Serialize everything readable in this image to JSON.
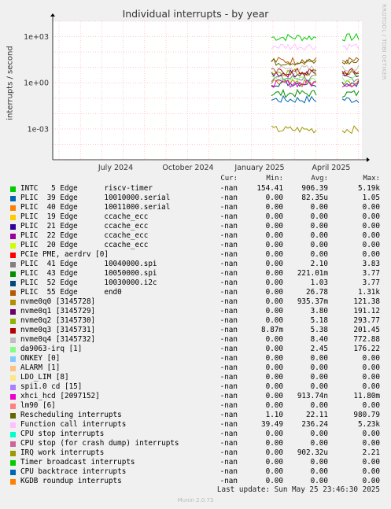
{
  "chart_data": {
    "type": "line",
    "title": "Individual interrupts - by year",
    "ylabel": "interrupts / second",
    "yscale": "log",
    "ylim": [
      1e-05,
      10000
    ],
    "y_ticks": [
      "1e+03",
      "1e+00",
      "1e-03"
    ],
    "x_ticks": [
      "July 2024",
      "October 2024",
      "January 2025",
      "April 2025"
    ],
    "grid": true,
    "series": [
      {
        "name": "INTC   5 Edge      riscv-timer",
        "color": "#00cc00",
        "approx_level": 900
      },
      {
        "name": "PLIC  39 Edge      10010000.serial",
        "color": "#0066b3",
        "approx_level": 0.08
      },
      {
        "name": "PLIC  40 Edge      10011000.serial",
        "color": "#ff8000",
        "approx_level": 0
      },
      {
        "name": "PLIC  19 Edge      ccache_ecc",
        "color": "#ffcc00",
        "approx_level": 0
      },
      {
        "name": "PLIC  21 Edge      ccache_ecc",
        "color": "#330099",
        "approx_level": 0
      },
      {
        "name": "PLIC  22 Edge      ccache_ecc",
        "color": "#990099",
        "approx_level": 0
      },
      {
        "name": "PLIC  20 Edge      ccache_ecc",
        "color": "#ccff00",
        "approx_level": 0
      },
      {
        "name": "PCIe PME, aerdrv [0]",
        "color": "#ff0000",
        "approx_level": 0
      },
      {
        "name": "PLIC  41 Edge      10040000.spi",
        "color": "#808080",
        "approx_level": 2
      },
      {
        "name": "PLIC  43 Edge      10050000.spi",
        "color": "#008f00",
        "approx_level": 0.2
      },
      {
        "name": "PLIC  52 Edge      10030000.i2c",
        "color": "#00487d",
        "approx_level": 1
      },
      {
        "name": "PLIC  55 Edge      end0",
        "color": "#b35a00",
        "approx_level": 27
      },
      {
        "name": "nvme0q0 [3145728]",
        "color": "#b38f00",
        "approx_level": 0.9
      },
      {
        "name": "nvme0q1 [3145729]",
        "color": "#6b006b",
        "approx_level": 4
      },
      {
        "name": "nvme0q2 [3145730]",
        "color": "#8fb300",
        "approx_level": 5
      },
      {
        "name": "nvme0q3 [3145731]",
        "color": "#b30000",
        "approx_level": 5
      },
      {
        "name": "nvme0q4 [3145732]",
        "color": "#bebebe",
        "approx_level": 8
      },
      {
        "name": "da9063-irq [1]",
        "color": "#80ff80",
        "approx_level": 2
      },
      {
        "name": "ONKEY [0]",
        "color": "#80c9ff",
        "approx_level": 0
      },
      {
        "name": "ALARM [1]",
        "color": "#ffc080",
        "approx_level": 0
      },
      {
        "name": "LDO_LIM [8]",
        "color": "#ffe680",
        "approx_level": 0
      },
      {
        "name": "spi1.0 cd [15]",
        "color": "#aa80ff",
        "approx_level": 0
      },
      {
        "name": "xhci_hcd [2097152]",
        "color": "#ee00cc",
        "approx_level": 0.9
      },
      {
        "name": "lm90 [6]",
        "color": "#ff8080",
        "approx_level": 0
      },
      {
        "name": "Rescheduling interrupts",
        "color": "#666600",
        "approx_level": 22
      },
      {
        "name": "Function call interrupts",
        "color": "#ffbfff",
        "approx_level": 236
      },
      {
        "name": "CPU stop interrupts",
        "color": "#00ffcc",
        "approx_level": 0
      },
      {
        "name": "CPU stop (for crash dump) interrupts",
        "color": "#cc6699",
        "approx_level": 0
      },
      {
        "name": "IRQ work interrupts",
        "color": "#999900",
        "approx_level": 0.0009
      },
      {
        "name": "Timer broadcast interrupts",
        "color": "#00cc00",
        "approx_level": 0
      },
      {
        "name": "CPU backtrace interrupts",
        "color": "#0066b3",
        "approx_level": 0
      },
      {
        "name": "KGDB roundup interrupts",
        "color": "#ff8000",
        "approx_level": 0
      }
    ]
  },
  "legend": {
    "headers": [
      "Cur:",
      "Min:",
      "Avg:",
      "Max:"
    ],
    "rows": [
      [
        "INTC   5 Edge      riscv-timer",
        "-nan",
        "154.41",
        "906.39",
        "5.19k"
      ],
      [
        "PLIC  39 Edge      10010000.serial",
        "-nan",
        "0.00",
        "82.35u",
        "1.05"
      ],
      [
        "PLIC  40 Edge      10011000.serial",
        "-nan",
        "0.00",
        "0.00",
        "0.00"
      ],
      [
        "PLIC  19 Edge      ccache_ecc",
        "-nan",
        "0.00",
        "0.00",
        "0.00"
      ],
      [
        "PLIC  21 Edge      ccache_ecc",
        "-nan",
        "0.00",
        "0.00",
        "0.00"
      ],
      [
        "PLIC  22 Edge      ccache_ecc",
        "-nan",
        "0.00",
        "0.00",
        "0.00"
      ],
      [
        "PLIC  20 Edge      ccache_ecc",
        "-nan",
        "0.00",
        "0.00",
        "0.00"
      ],
      [
        "PCIe PME, aerdrv [0]",
        "-nan",
        "0.00",
        "0.00",
        "0.00"
      ],
      [
        "PLIC  41 Edge      10040000.spi",
        "-nan",
        "0.00",
        "2.10",
        "3.83"
      ],
      [
        "PLIC  43 Edge      10050000.spi",
        "-nan",
        "0.00",
        "221.01m",
        "3.77"
      ],
      [
        "PLIC  52 Edge      10030000.i2c",
        "-nan",
        "0.00",
        "1.03",
        "3.77"
      ],
      [
        "PLIC  55 Edge      end0",
        "-nan",
        "0.00",
        "26.78",
        "1.31k"
      ],
      [
        "nvme0q0 [3145728]",
        "-nan",
        "0.00",
        "935.37m",
        "121.38"
      ],
      [
        "nvme0q1 [3145729]",
        "-nan",
        "0.00",
        "3.80",
        "191.12"
      ],
      [
        "nvme0q2 [3145730]",
        "-nan",
        "0.00",
        "5.18",
        "293.77"
      ],
      [
        "nvme0q3 [3145731]",
        "-nan",
        "8.87m",
        "5.38",
        "201.45"
      ],
      [
        "nvme0q4 [3145732]",
        "-nan",
        "0.00",
        "8.40",
        "772.88"
      ],
      [
        "da9063-irq [1]",
        "-nan",
        "0.00",
        "2.45",
        "176.22"
      ],
      [
        "ONKEY [0]",
        "-nan",
        "0.00",
        "0.00",
        "0.00"
      ],
      [
        "ALARM [1]",
        "-nan",
        "0.00",
        "0.00",
        "0.00"
      ],
      [
        "LDO_LIM [8]",
        "-nan",
        "0.00",
        "0.00",
        "0.00"
      ],
      [
        "spi1.0 cd [15]",
        "-nan",
        "0.00",
        "0.00",
        "0.00"
      ],
      [
        "xhci_hcd [2097152]",
        "-nan",
        "0.00",
        "913.74n",
        "11.80m"
      ],
      [
        "lm90 [6]",
        "-nan",
        "0.00",
        "0.00",
        "0.00"
      ],
      [
        "Rescheduling interrupts",
        "-nan",
        "1.10",
        "22.11",
        "980.79"
      ],
      [
        "Function call interrupts",
        "-nan",
        "39.49",
        "236.24",
        "5.23k"
      ],
      [
        "CPU stop interrupts",
        "-nan",
        "0.00",
        "0.00",
        "0.00"
      ],
      [
        "CPU stop (for crash dump) interrupts",
        "-nan",
        "0.00",
        "0.00",
        "0.00"
      ],
      [
        "IRQ work interrupts",
        "-nan",
        "0.00",
        "902.32u",
        "2.21"
      ],
      [
        "Timer broadcast interrupts",
        "-nan",
        "0.00",
        "0.00",
        "0.00"
      ],
      [
        "CPU backtrace interrupts",
        "-nan",
        "0.00",
        "0.00",
        "0.00"
      ],
      [
        "KGDB roundup interrupts",
        "-nan",
        "0.00",
        "0.00",
        "0.00"
      ]
    ]
  },
  "footer": {
    "last_update": "Last update: Sun May 25 23:46:30 2025",
    "munin": "Munin 2.0.73",
    "side_text": "RRDTOOL / TOBI OETIKER"
  }
}
